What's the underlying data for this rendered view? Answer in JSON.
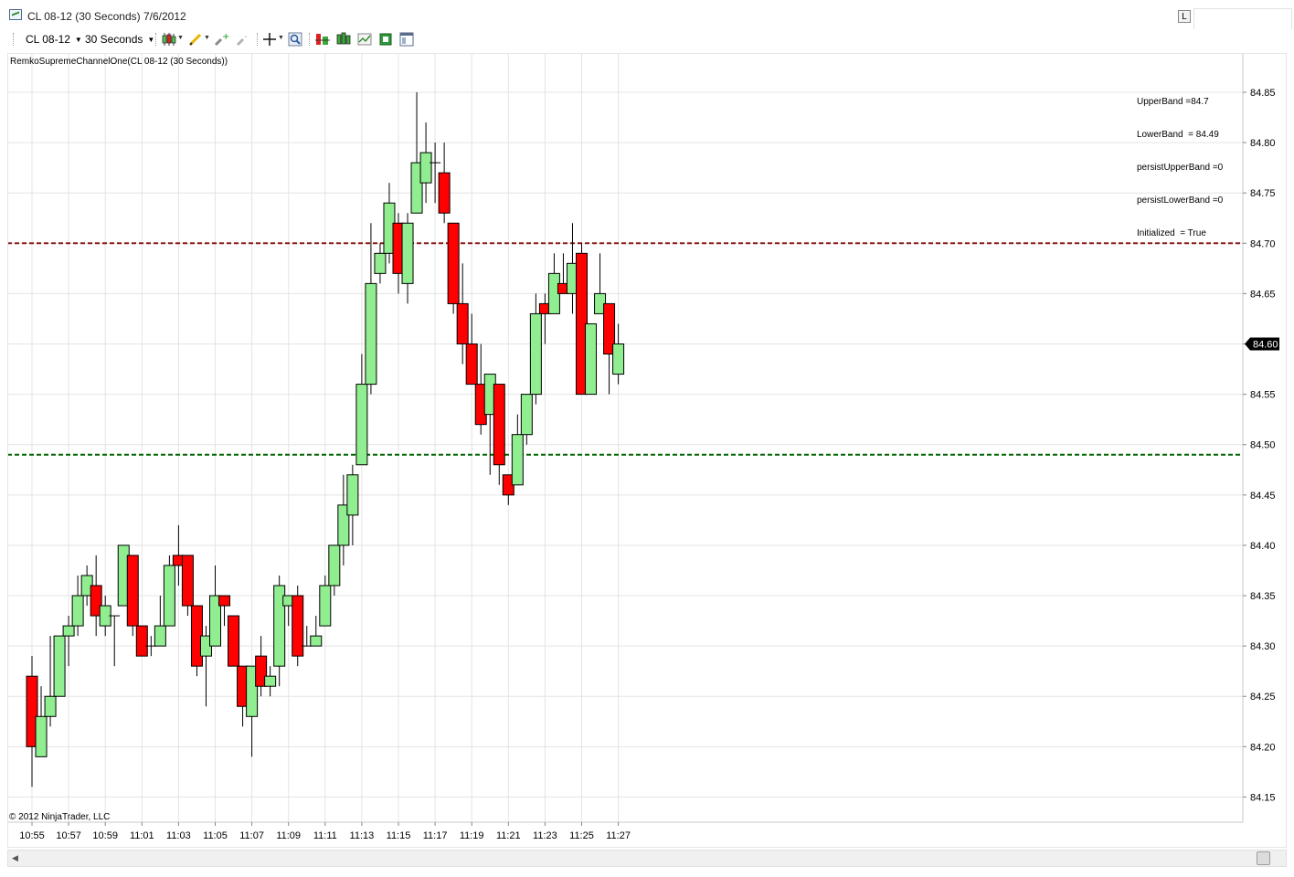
{
  "window": {
    "title": "CL 08-12 (30 Seconds)  7/6/2012",
    "l_button": "L"
  },
  "toolbar": {
    "instrument": "CL 08-12",
    "interval": "30 Seconds"
  },
  "indicator_label": "RemkoSupremeChannelOne(CL 08-12 (30 Seconds))",
  "info_lines": [
    "UpperBand =84.7",
    "LowerBand  = 84.49",
    "persistUpperBand =0",
    "persistLowerBand =0",
    "Initialized  = True"
  ],
  "copyright": "© 2012 NinjaTrader, LLC",
  "colors": {
    "up_candle": "#90EE90",
    "down_candle": "#FF0000",
    "upper_band": "#8B1A1A",
    "lower_band": "#006400",
    "grid": "#e4e4e4",
    "price_marker": "#000000"
  },
  "chart_data": {
    "type": "candlestick",
    "x_tick_labels": [
      "10:55",
      "10:57",
      "10:59",
      "11:01",
      "11:03",
      "11:05",
      "11:07",
      "11:09",
      "11:11",
      "11:13",
      "11:15",
      "11:17",
      "11:19",
      "11:21",
      "11:23",
      "11:25",
      "11:27"
    ],
    "y_tick_labels": [
      "84.15",
      "84.20",
      "84.25",
      "84.30",
      "84.35",
      "84.40",
      "84.45",
      "84.50",
      "84.55",
      "84.60",
      "84.65",
      "84.70",
      "84.75",
      "84.80",
      "84.85"
    ],
    "ylim": [
      84.125,
      84.889
    ],
    "grid": true,
    "last_price": "84.60",
    "upper_band": 84.7,
    "lower_band": 84.49,
    "candles": [
      {
        "t": "10:55:00",
        "o": 84.27,
        "h": 84.29,
        "l": 84.16,
        "c": 84.2
      },
      {
        "t": "10:55:30",
        "o": 84.19,
        "h": 84.26,
        "l": 84.19,
        "c": 84.23
      },
      {
        "t": "10:56:00",
        "o": 84.23,
        "h": 84.31,
        "l": 84.22,
        "c": 84.25
      },
      {
        "t": "10:56:30",
        "o": 84.25,
        "h": 84.31,
        "l": 84.25,
        "c": 84.31
      },
      {
        "t": "10:57:00",
        "o": 84.31,
        "h": 84.33,
        "l": 84.28,
        "c": 84.32
      },
      {
        "t": "10:57:30",
        "o": 84.32,
        "h": 84.37,
        "l": 84.31,
        "c": 84.35
      },
      {
        "t": "10:58:00",
        "o": 84.35,
        "h": 84.38,
        "l": 84.34,
        "c": 84.37
      },
      {
        "t": "10:58:30",
        "o": 84.36,
        "h": 84.39,
        "l": 84.31,
        "c": 84.33
      },
      {
        "t": "10:59:00",
        "o": 84.32,
        "h": 84.35,
        "l": 84.31,
        "c": 84.34
      },
      {
        "t": "10:59:30",
        "o": 84.33,
        "h": 84.33,
        "l": 84.28,
        "c": 84.33
      },
      {
        "t": "11:00:00",
        "o": 84.34,
        "h": 84.4,
        "l": 84.34,
        "c": 84.4
      },
      {
        "t": "11:00:30",
        "o": 84.39,
        "h": 84.39,
        "l": 84.31,
        "c": 84.32
      },
      {
        "t": "11:01:00",
        "o": 84.32,
        "h": 84.32,
        "l": 84.29,
        "c": 84.29
      },
      {
        "t": "11:01:30",
        "o": 84.3,
        "h": 84.31,
        "l": 84.29,
        "c": 84.3
      },
      {
        "t": "11:02:00",
        "o": 84.3,
        "h": 84.35,
        "l": 84.3,
        "c": 84.32
      },
      {
        "t": "11:02:30",
        "o": 84.32,
        "h": 84.39,
        "l": 84.32,
        "c": 84.38
      },
      {
        "t": "11:03:00",
        "o": 84.39,
        "h": 84.42,
        "l": 84.36,
        "c": 84.38
      },
      {
        "t": "11:03:30",
        "o": 84.39,
        "h": 84.39,
        "l": 84.33,
        "c": 84.34
      },
      {
        "t": "11:04:00",
        "o": 84.34,
        "h": 84.34,
        "l": 84.27,
        "c": 84.28
      },
      {
        "t": "11:04:30",
        "o": 84.29,
        "h": 84.32,
        "l": 84.24,
        "c": 84.31
      },
      {
        "t": "11:05:00",
        "o": 84.3,
        "h": 84.38,
        "l": 84.3,
        "c": 84.35
      },
      {
        "t": "11:05:30",
        "o": 84.35,
        "h": 84.35,
        "l": 84.32,
        "c": 84.34
      },
      {
        "t": "11:06:00",
        "o": 84.33,
        "h": 84.33,
        "l": 84.28,
        "c": 84.28
      },
      {
        "t": "11:06:30",
        "o": 84.28,
        "h": 84.28,
        "l": 84.22,
        "c": 84.24
      },
      {
        "t": "11:07:00",
        "o": 84.23,
        "h": 84.28,
        "l": 84.19,
        "c": 84.28
      },
      {
        "t": "11:07:30",
        "o": 84.29,
        "h": 84.31,
        "l": 84.25,
        "c": 84.26
      },
      {
        "t": "11:08:00",
        "o": 84.26,
        "h": 84.28,
        "l": 84.25,
        "c": 84.27
      },
      {
        "t": "11:08:30",
        "o": 84.28,
        "h": 84.37,
        "l": 84.26,
        "c": 84.36
      },
      {
        "t": "11:09:00",
        "o": 84.34,
        "h": 84.35,
        "l": 84.32,
        "c": 84.35
      },
      {
        "t": "11:09:30",
        "o": 84.35,
        "h": 84.36,
        "l": 84.28,
        "c": 84.29
      },
      {
        "t": "11:10:00",
        "o": 84.3,
        "h": 84.32,
        "l": 84.3,
        "c": 84.3
      },
      {
        "t": "11:10:30",
        "o": 84.3,
        "h": 84.33,
        "l": 84.3,
        "c": 84.31
      },
      {
        "t": "11:11:00",
        "o": 84.32,
        "h": 84.37,
        "l": 84.32,
        "c": 84.36
      },
      {
        "t": "11:11:30",
        "o": 84.36,
        "h": 84.4,
        "l": 84.35,
        "c": 84.4
      },
      {
        "t": "11:12:00",
        "o": 84.4,
        "h": 84.47,
        "l": 84.38,
        "c": 84.44
      },
      {
        "t": "11:12:30",
        "o": 84.43,
        "h": 84.48,
        "l": 84.4,
        "c": 84.47
      },
      {
        "t": "11:13:00",
        "o": 84.48,
        "h": 84.59,
        "l": 84.48,
        "c": 84.56
      },
      {
        "t": "11:13:30",
        "o": 84.56,
        "h": 84.72,
        "l": 84.55,
        "c": 84.66
      },
      {
        "t": "11:14:00",
        "o": 84.67,
        "h": 84.7,
        "l": 84.66,
        "c": 84.69
      },
      {
        "t": "11:14:30",
        "o": 84.69,
        "h": 84.76,
        "l": 84.68,
        "c": 84.74
      },
      {
        "t": "11:15:00",
        "o": 84.72,
        "h": 84.73,
        "l": 84.65,
        "c": 84.67
      },
      {
        "t": "11:15:30",
        "o": 84.66,
        "h": 84.73,
        "l": 84.64,
        "c": 84.72
      },
      {
        "t": "11:16:00",
        "o": 84.73,
        "h": 84.85,
        "l": 84.73,
        "c": 84.78
      },
      {
        "t": "11:16:30",
        "o": 84.76,
        "h": 84.82,
        "l": 84.74,
        "c": 84.79
      },
      {
        "t": "11:17:00",
        "o": 84.78,
        "h": 84.8,
        "l": 84.74,
        "c": 84.78
      },
      {
        "t": "11:17:30",
        "o": 84.77,
        "h": 84.8,
        "l": 84.72,
        "c": 84.73
      },
      {
        "t": "11:18:00",
        "o": 84.72,
        "h": 84.72,
        "l": 84.63,
        "c": 84.64
      },
      {
        "t": "11:18:30",
        "o": 84.64,
        "h": 84.68,
        "l": 84.58,
        "c": 84.6
      },
      {
        "t": "11:19:00",
        "o": 84.6,
        "h": 84.63,
        "l": 84.56,
        "c": 84.56
      },
      {
        "t": "11:19:30",
        "o": 84.56,
        "h": 84.6,
        "l": 84.51,
        "c": 84.52
      },
      {
        "t": "11:20:00",
        "o": 84.53,
        "h": 84.57,
        "l": 84.47,
        "c": 84.57
      },
      {
        "t": "11:20:30",
        "o": 84.56,
        "h": 84.56,
        "l": 84.46,
        "c": 84.48
      },
      {
        "t": "11:21:00",
        "o": 84.47,
        "h": 84.47,
        "l": 84.44,
        "c": 84.45
      },
      {
        "t": "11:21:30",
        "o": 84.46,
        "h": 84.53,
        "l": 84.46,
        "c": 84.51
      },
      {
        "t": "11:22:00",
        "o": 84.51,
        "h": 84.55,
        "l": 84.5,
        "c": 84.55
      },
      {
        "t": "11:22:30",
        "o": 84.55,
        "h": 84.65,
        "l": 84.54,
        "c": 84.63
      },
      {
        "t": "11:23:00",
        "o": 84.64,
        "h": 84.65,
        "l": 84.6,
        "c": 84.63
      },
      {
        "t": "11:23:30",
        "o": 84.63,
        "h": 84.69,
        "l": 84.63,
        "c": 84.67
      },
      {
        "t": "11:24:00",
        "o": 84.66,
        "h": 84.69,
        "l": 84.65,
        "c": 84.65
      },
      {
        "t": "11:24:30",
        "o": 84.65,
        "h": 84.72,
        "l": 84.63,
        "c": 84.68
      },
      {
        "t": "11:25:00",
        "o": 84.69,
        "h": 84.7,
        "l": 84.55,
        "c": 84.55
      },
      {
        "t": "11:25:30",
        "o": 84.55,
        "h": 84.62,
        "l": 84.55,
        "c": 84.62
      },
      {
        "t": "11:26:00",
        "o": 84.63,
        "h": 84.69,
        "l": 84.63,
        "c": 84.65
      },
      {
        "t": "11:26:30",
        "o": 84.64,
        "h": 84.64,
        "l": 84.55,
        "c": 84.59
      },
      {
        "t": "11:27:00",
        "o": 84.57,
        "h": 84.62,
        "l": 84.56,
        "c": 84.6
      }
    ]
  }
}
